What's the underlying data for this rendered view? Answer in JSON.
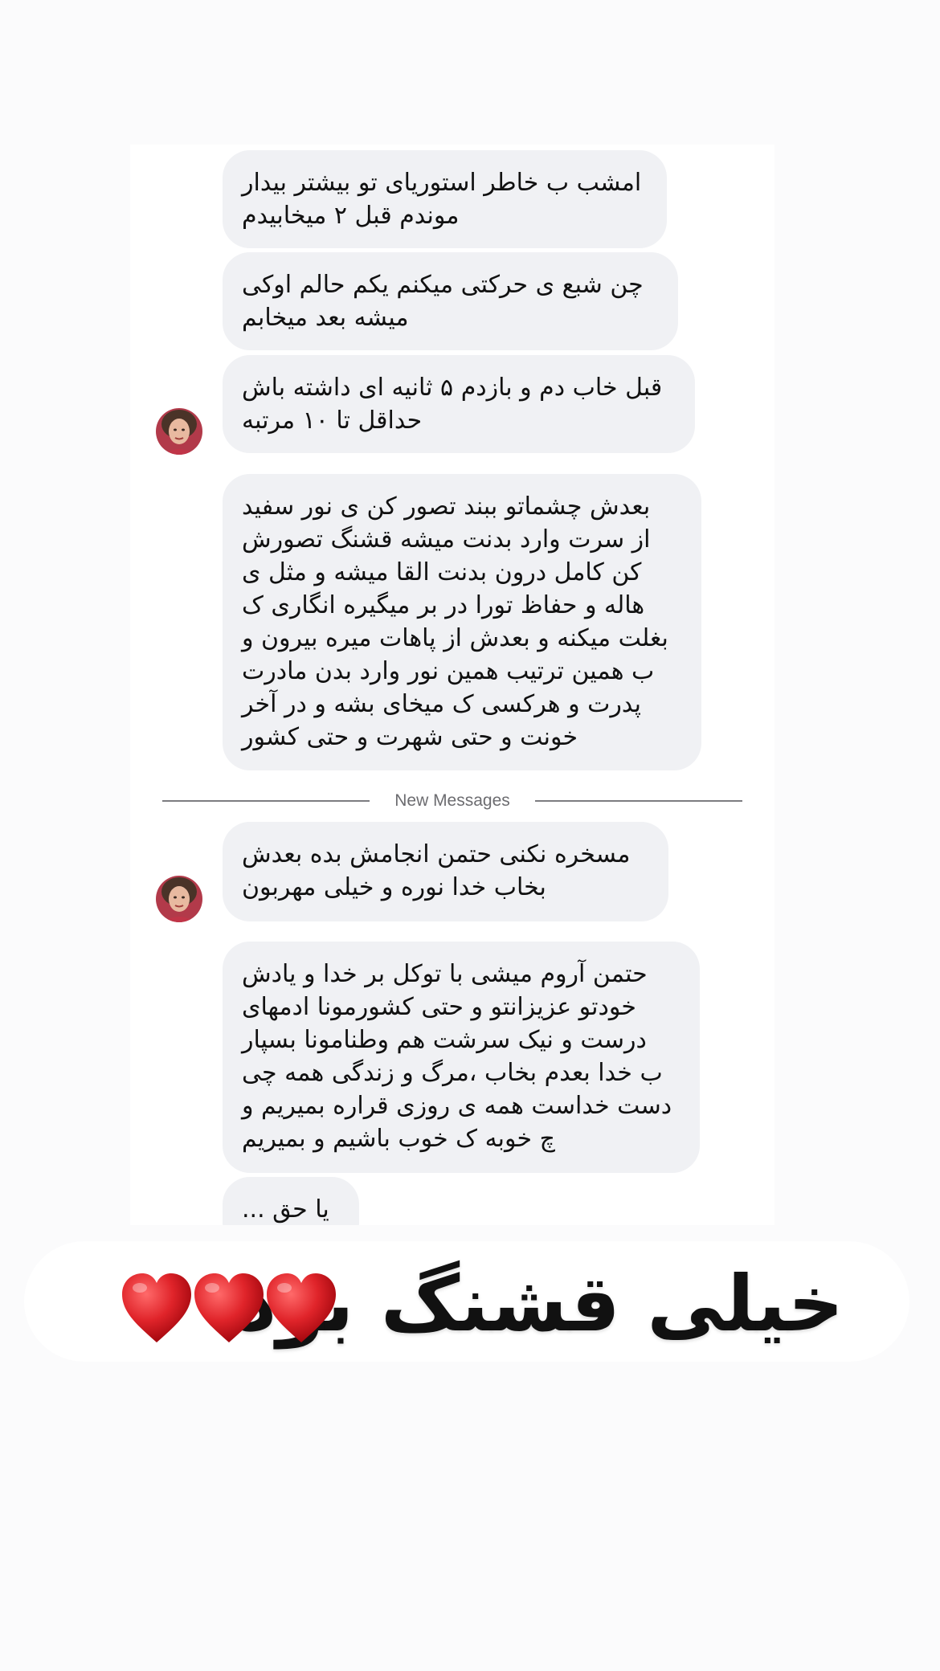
{
  "messages": [
    {
      "lines": [
        "امشب ب خاطر استوریای تو بیشتر بیدار",
        "موندم قبل ۲ میخابیدم"
      ]
    },
    {
      "lines": [
        "چن شبع ی حرکتی میکنم یکم حالم اوکی",
        "میشه بعد میخابم"
      ]
    },
    {
      "lines": [
        "قبل خاب دم و بازدم ۵ ثانیه ای داشته باش",
        "حداقل تا ۱۰ مرتبه"
      ]
    },
    {
      "lines": [
        "بعدش چشماتو ببند تصور کن ی نور سفید",
        "از سرت وارد بدنت میشه قشنگ تصورش",
        "کن کامل درون بدنت القا میشه و مثل ی",
        "هاله و حفاظ تورا در بر میگیره انگاری ک",
        "بغلت میکنه و بعدش از پاهات میره بیرون و",
        "ب همین ترتیب همین نور وارد بدن مادرت",
        "پدرت و هرکسی ک میخای بشه و در آخر",
        "خونت و حتی شهرت و حتی کشور"
      ]
    },
    {
      "lines": [
        "مسخره نکنی حتمن انجامش بده بعدش",
        "بخاب خدا نوره و خیلی مهربون"
      ]
    },
    {
      "lines": [
        "حتمن آروم میشی با توکل بر خدا و یادش",
        "خودتو عزیزانتو و حتی کشورمونا ادمهای",
        "درست و نیک سرشت هم وطنامونا بسپار",
        "ب خدا بعدم بخاب ،مرگ و زندگی همه چی",
        "دست خداست همه ی روزی قراره بمیریم و",
        "چ خوبه ک خوب باشیم و بمیریم"
      ]
    },
    {
      "lines": [
        "یا حق ..."
      ]
    }
  ],
  "divider": {
    "label": "New Messages"
  },
  "caption": {
    "text": "خیلی قشنگ بود",
    "emoji": "heart-red-icon x3"
  },
  "colors": {
    "bubble": "#f0f1f4",
    "heart": "#e0242a"
  }
}
